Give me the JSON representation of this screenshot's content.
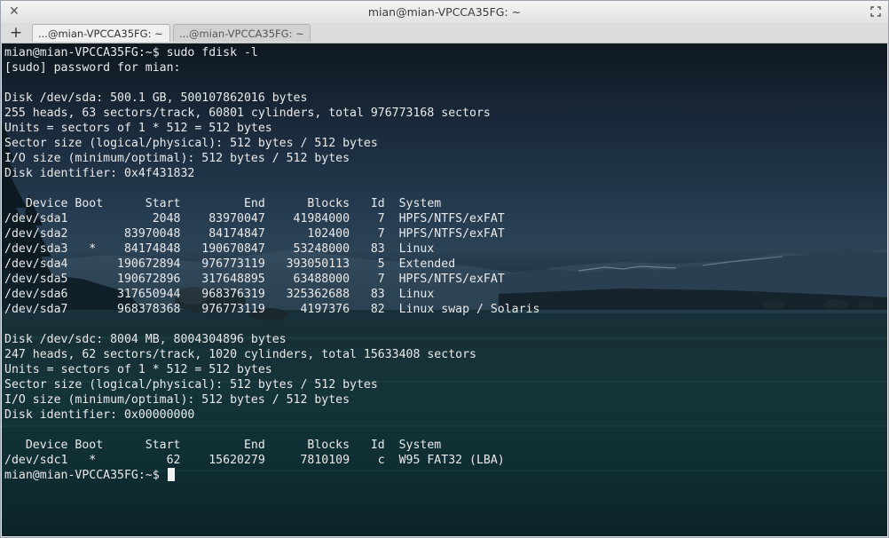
{
  "window": {
    "title": "mian@mian-VPCCA35FG: ~",
    "close_glyph": "✕"
  },
  "tabs": {
    "new_tab_glyph": "+",
    "items": [
      {
        "label": "...@mian-VPCCA35FG: ~",
        "active": true
      },
      {
        "label": "...@mian-VPCCA35FG: ~",
        "active": false
      }
    ],
    "close_glyph": "✕"
  },
  "terminal": {
    "lines": [
      "mian@mian-VPCCA35FG:~$ sudo fdisk -l",
      "[sudo] password for mian:",
      "",
      "Disk /dev/sda: 500.1 GB, 500107862016 bytes",
      "255 heads, 63 sectors/track, 60801 cylinders, total 976773168 sectors",
      "Units = sectors of 1 * 512 = 512 bytes",
      "Sector size (logical/physical): 512 bytes / 512 bytes",
      "I/O size (minimum/optimal): 512 bytes / 512 bytes",
      "Disk identifier: 0x4f431832",
      "",
      "   Device Boot      Start         End      Blocks   Id  System",
      "/dev/sda1            2048    83970047    41984000    7  HPFS/NTFS/exFAT",
      "/dev/sda2        83970048    84174847      102400    7  HPFS/NTFS/exFAT",
      "/dev/sda3   *    84174848   190670847    53248000   83  Linux",
      "/dev/sda4       190672894   976773119   393050113    5  Extended",
      "/dev/sda5       190672896   317648895    63488000    7  HPFS/NTFS/exFAT",
      "/dev/sda6       317650944   968376319   325362688   83  Linux",
      "/dev/sda7       968378368   976773119     4197376   82  Linux swap / Solaris",
      "",
      "Disk /dev/sdc: 8004 MB, 8004304896 bytes",
      "247 heads, 62 sectors/track, 1020 cylinders, total 15633408 sectors",
      "Units = sectors of 1 * 512 = 512 bytes",
      "Sector size (logical/physical): 512 bytes / 512 bytes",
      "I/O size (minimum/optimal): 512 bytes / 512 bytes",
      "Disk identifier: 0x00000000",
      "",
      "   Device Boot      Start         End      Blocks   Id  System",
      "/dev/sdc1   *          62    15620279     7810109    c  W95 FAT32 (LBA)"
    ],
    "prompt": "mian@mian-VPCCA35FG:~$ "
  }
}
